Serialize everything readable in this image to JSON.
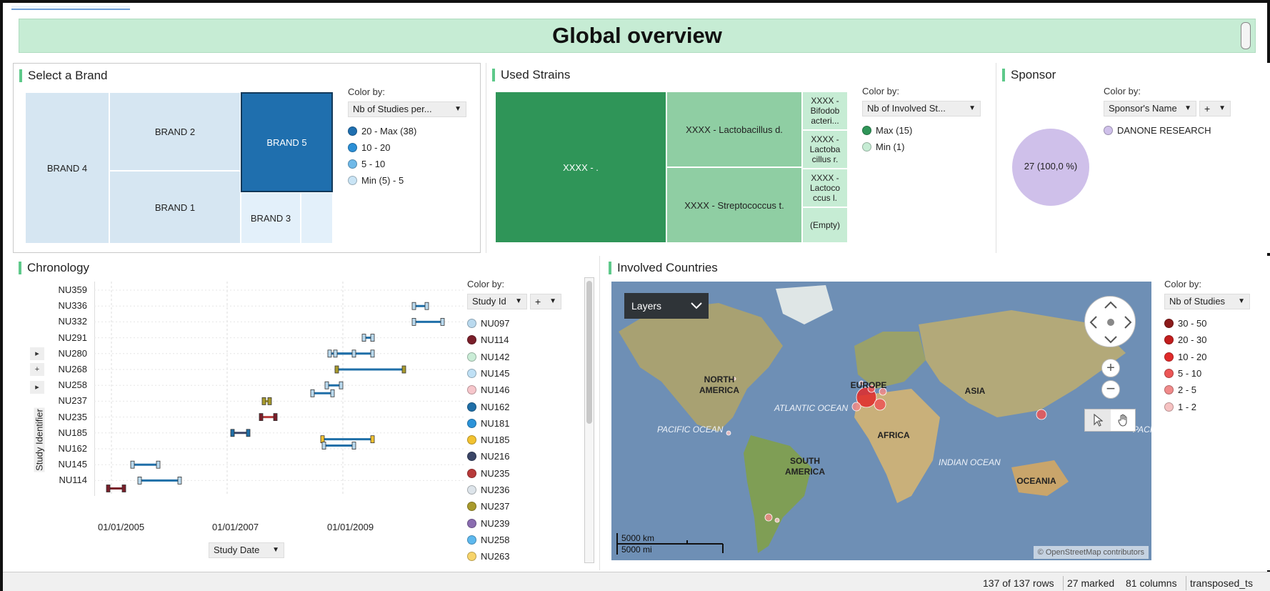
{
  "page_title": "Global overview",
  "brand_panel": {
    "title": "Select a Brand",
    "color_by_label": "Color by:",
    "color_by_value": "Nb of Studies per...",
    "legend": [
      {
        "label": "20 - Max (38)",
        "color": "#1f6fb0"
      },
      {
        "label": "10 - 20",
        "color": "#2b8fd6"
      },
      {
        "label": "5 - 10",
        "color": "#6fb9e8"
      },
      {
        "label": "Min (5) - 5",
        "color": "#c9e4f5"
      }
    ],
    "tiles": [
      "BRAND 4",
      "BRAND 2",
      "BRAND 5",
      "BRAND 1",
      "BRAND 3"
    ],
    "colors": {
      "light": "#d6e6f2",
      "lighter": "#e3f0fa",
      "selected": "#1f6fae"
    }
  },
  "strains_panel": {
    "title": "Used Strains",
    "color_by_label": "Color by:",
    "color_by_value": "Nb of Involved St...",
    "legend": [
      {
        "label": "Max (15)",
        "color": "#2f9558"
      },
      {
        "label": "Min (1)",
        "color": "#c6ecd4"
      }
    ],
    "tiles": [
      "XXXX - .",
      "XXXX - Lactobacillus d.",
      "XXXX - Streptococcus t.",
      "XXXX - Bifodob acteri...",
      "XXXX - Lactoba cillus r.",
      "XXXX - Lactoco ccus l.",
      "(Empty)"
    ],
    "colors": {
      "dark": "#2f9558",
      "mid": "#8fcea3",
      "light": "#c6ecd4"
    }
  },
  "sponsor_panel": {
    "title": "Sponsor",
    "color_by_label": "Color by:",
    "color_by_value": "Sponsor's Name",
    "plus_label": "+",
    "legend": [
      {
        "label": "DANONE RESEARCH",
        "color": "#cfc0ea"
      }
    ],
    "pie_label": "27 (100,0 %)",
    "pie_color": "#cfc0ea"
  },
  "chronology_panel": {
    "title": "Chronology",
    "y_axis_label": "Study Identifier",
    "x_axis_dropdown": "Study Date",
    "color_by_label": "Color by:",
    "color_by_value": "Study Id",
    "plus_label": "+",
    "side_buttons": [
      "▸",
      "+",
      "▸"
    ],
    "y_ticks": [
      "NU359",
      "NU336",
      "NU332",
      "NU291",
      "NU280",
      "NU268",
      "NU258",
      "NU237",
      "NU235",
      "NU185",
      "NU162",
      "NU145",
      "NU114"
    ],
    "x_ticks": [
      "01/01/2005",
      "01/01/2007",
      "01/01/2009"
    ],
    "legend": [
      {
        "label": "NU097",
        "color": "#b9d9ee"
      },
      {
        "label": "NU114",
        "color": "#7a1f2a"
      },
      {
        "label": "NU142",
        "color": "#c9ecd6"
      },
      {
        "label": "NU145",
        "color": "#bfe0f5"
      },
      {
        "label": "NU146",
        "color": "#f6c6cb"
      },
      {
        "label": "NU162",
        "color": "#1f6fa8"
      },
      {
        "label": "NU181",
        "color": "#2b93d9"
      },
      {
        "label": "NU185",
        "color": "#f2c230"
      },
      {
        "label": "NU216",
        "color": "#3a4566"
      },
      {
        "label": "NU235",
        "color": "#b83a3a"
      },
      {
        "label": "NU236",
        "color": "#dde4ea"
      },
      {
        "label": "NU237",
        "color": "#a89a2c"
      },
      {
        "label": "NU239",
        "color": "#8a6cb0"
      },
      {
        "label": "NU258",
        "color": "#5db8ee"
      },
      {
        "label": "NU263",
        "color": "#f7d46a"
      }
    ]
  },
  "countries_panel": {
    "title": "Involved Countries",
    "layers_label": "Layers",
    "color_by_label": "Color by:",
    "color_by_value": "Nb of Studies",
    "legend": [
      {
        "label": "30 - 50",
        "color": "#8b1a1a"
      },
      {
        "label": "20 - 30",
        "color": "#c21d1d"
      },
      {
        "label": "10 - 20",
        "color": "#e02a2a"
      },
      {
        "label": "5 - 10",
        "color": "#ec5656"
      },
      {
        "label": "2 - 5",
        "color": "#f08a8a"
      },
      {
        "label": "1 - 2",
        "color": "#f6c2c2"
      }
    ],
    "continents": [
      "NORTH AMERICA",
      "EUROPE",
      "ASIA",
      "AFRICA",
      "SOUTH AMERICA",
      "OCEANIA"
    ],
    "oceans": [
      "ATLANTIC OCEAN",
      "PACIFIC OCEAN",
      "INDIAN OCEAN",
      "PACI"
    ],
    "scale_km": "5000 km",
    "scale_mi": "5000 mi",
    "attribution": "© OpenStreetMap contributors"
  },
  "statusbar": {
    "rows": "137 of 137 rows",
    "marked": "27 marked",
    "columns": "81 columns",
    "table": "transposed_ts"
  }
}
